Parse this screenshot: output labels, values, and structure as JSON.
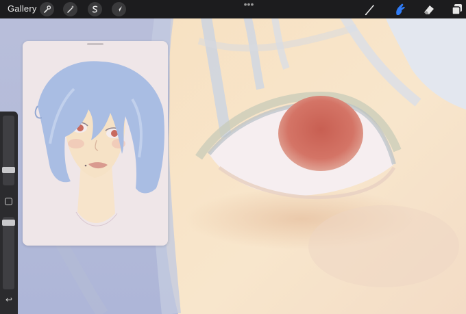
{
  "toolbar": {
    "gallery_label": "Gallery",
    "actions_icon": "wrench-icon",
    "adjustments_icon": "magic-wand-icon",
    "selection_icon": "selection-s-icon",
    "transform_icon": "arrow-cursor-icon",
    "more_icon": "ellipsis-icon",
    "brush_icon": "brush-icon",
    "smudge_icon": "smudge-finger-icon",
    "eraser_icon": "eraser-icon",
    "layers_icon": "layers-icon",
    "active_tool": "smudge",
    "active_color": "#2f7bf5"
  },
  "sidebar": {
    "size_slider_level": 0.32,
    "opacity_slider_level": 0.1,
    "modify_icon": "square-icon",
    "undo_icon": "undo-arrow-icon"
  },
  "reference_window": {
    "handle_icon": "drag-handle-icon",
    "content": "portrait-sketch"
  },
  "colors": {
    "toolbar_bg": "#1c1c1e",
    "skin": "#f6e4c8",
    "hair": "#a9bde3",
    "iris": "#cf6e60",
    "reference_bg": "#efe6e8"
  }
}
